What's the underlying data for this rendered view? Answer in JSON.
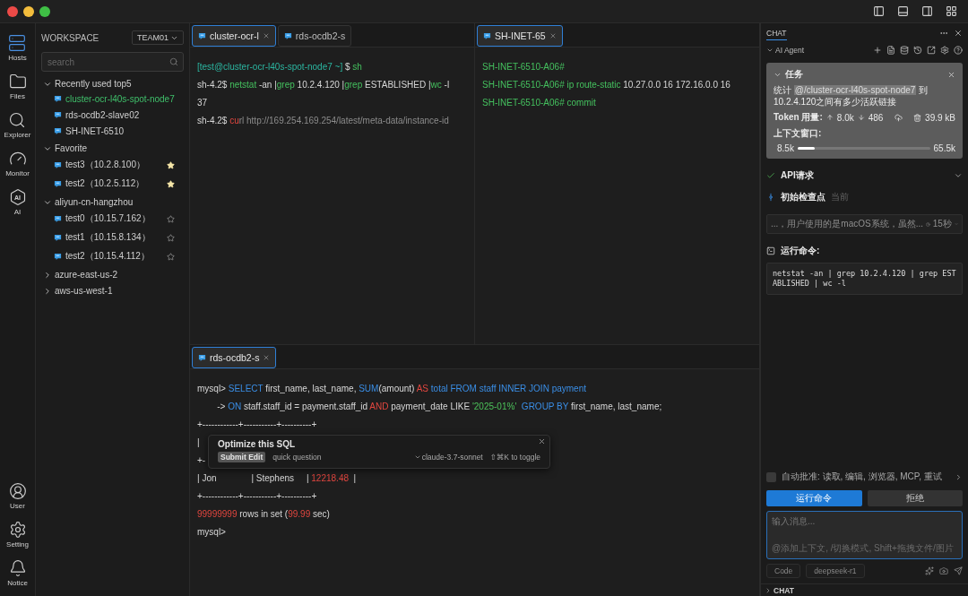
{
  "rail": {
    "top": [
      {
        "kind": "hosts",
        "label": "Hosts",
        "selected": true
      },
      {
        "kind": "files",
        "label": "Files",
        "selected": false
      },
      {
        "kind": "explorer",
        "label": "Explorer",
        "selected": false
      },
      {
        "kind": "monitor",
        "label": "Monitor",
        "selected": false
      },
      {
        "kind": "ai",
        "label": "AI",
        "glyph": "AI",
        "selected": false
      }
    ],
    "bottom": [
      {
        "kind": "user",
        "label": "User",
        "selected": false
      },
      {
        "kind": "settings",
        "label": "Setting",
        "selected": false
      },
      {
        "kind": "notice",
        "label": "Notice",
        "selected": false
      }
    ]
  },
  "sidebar": {
    "title": "WORKSPACE",
    "team": "TEAM01",
    "search": {
      "placeholder": "search"
    },
    "groups": [
      {
        "label": "Recently used top5",
        "expanded": true,
        "children": [
          {
            "label": "cluster-ocr-l40s-spot-node7",
            "selected": true
          },
          {
            "label": "rds-ocdb2-slave02",
            "selected": false
          },
          {
            "label": "SH-INET-6510",
            "selected": false
          }
        ]
      },
      {
        "label": "Favorite",
        "expanded": true,
        "children": [
          {
            "label": "test3（10.2.8.100）",
            "selected": false,
            "starred": true
          },
          {
            "label": "test2（10.2.5.112）",
            "selected": false,
            "starred": true
          }
        ]
      },
      {
        "label": "aliyun-cn-hangzhou",
        "expanded": true,
        "children": [
          {
            "label": "test0（10.15.7.162）",
            "selected": false,
            "starred": false
          },
          {
            "label": "test1（10.15.8.134）",
            "selected": false,
            "starred": false
          },
          {
            "label": "test2（10.15.4.112）",
            "selected": false,
            "starred": false
          }
        ]
      },
      {
        "label": "azure-east-us-2",
        "expanded": false
      },
      {
        "label": "aws-us-west-1",
        "expanded": false
      }
    ]
  },
  "panes": [
    {
      "tabs": [
        {
          "label": "cluster-ocr-l",
          "selected": true,
          "closable": true
        },
        {
          "label": "rds-ocdb2-s",
          "selected": false,
          "closable": false
        }
      ],
      "lines": [
        [
          {
            "kind": "prompt",
            "text": "[test@cluster-ocr-l40s-spot-node7 ~]"
          },
          {
            "kind": "plain",
            "text": " $ "
          },
          {
            "kind": "cmd",
            "text": "sh"
          }
        ],
        [
          {
            "kind": "plain",
            "text": "sh-4.2$ "
          },
          {
            "kind": "cmd",
            "text": "netstat"
          },
          {
            "kind": "plain",
            "text": " -an |"
          },
          {
            "kind": "cmd",
            "text": "grep"
          },
          {
            "kind": "plain",
            "text": " 10.2.4.120 |"
          },
          {
            "kind": "cmd",
            "text": "grep"
          },
          {
            "kind": "plain",
            "text": " ESTABLISHED |"
          },
          {
            "kind": "cmd",
            "text": "wc"
          },
          {
            "kind": "plain",
            "text": " -l"
          }
        ],
        [
          {
            "kind": "plain",
            "text": "37"
          }
        ],
        [
          {
            "kind": "plain",
            "text": "sh-4.2$ "
          },
          {
            "kind": "error",
            "text": "cu"
          },
          {
            "kind": "dim",
            "text": "rl http://169.254.169.254/latest/meta-data/instance-id"
          }
        ]
      ]
    },
    {
      "tabs": [
        {
          "label": "SH-INET-65",
          "selected": true,
          "closable": true
        }
      ],
      "lines": [
        [
          {
            "kind": "cmd",
            "text": "SH-INET-6510-A06#"
          }
        ],
        [
          {
            "kind": "cmd",
            "text": "SH-INET-6510-A06# ip route-static"
          },
          {
            "kind": "plain",
            "text": " 10.27.0.0 16 172.16.0.0 16"
          }
        ],
        [
          {
            "kind": "cmd",
            "text": "SH-INET-6510-A06# commit"
          }
        ]
      ]
    },
    {
      "tabs": [
        {
          "label": "rds-ocdb2-s",
          "selected": true,
          "closable": true
        }
      ],
      "lines": [
        [
          {
            "kind": "plain",
            "text": "mysql> "
          },
          {
            "kind": "keyword",
            "text": "SELECT"
          },
          {
            "kind": "plain",
            "text": " first_name, last_name, "
          },
          {
            "kind": "keyword",
            "text": "SUM"
          },
          {
            "kind": "plain",
            "text": "(amount) "
          },
          {
            "kind": "error",
            "text": "AS"
          },
          {
            "kind": "keyword",
            "text": " total FROM staff INNER JOIN payment"
          }
        ],
        [
          {
            "kind": "plain",
            "text": "        -> "
          },
          {
            "kind": "keyword",
            "text": "ON"
          },
          {
            "kind": "plain",
            "text": " staff.staff_id = payment.staff_id "
          },
          {
            "kind": "error",
            "text": "AND"
          },
          {
            "kind": "plain",
            "text": " payment_date LIKE "
          },
          {
            "kind": "string",
            "text": "'2025-01%'"
          },
          {
            "kind": "keyword",
            "text": "  GROUP BY"
          },
          {
            "kind": "plain",
            "text": " first_name, last_name;"
          }
        ],
        [
          {
            "kind": "plain",
            "text": "+------------+-----------+----------+"
          }
        ],
        [
          {
            "kind": "plain",
            "text": "|"
          }
        ],
        [
          {
            "kind": "plain",
            "text": "+-"
          }
        ],
        [
          {
            "kind": "plain",
            "text": "| Jon              | Stephens     | "
          },
          {
            "kind": "error",
            "text": "12218.48"
          },
          {
            "kind": "plain",
            "text": "  |"
          }
        ],
        [
          {
            "kind": "plain",
            "text": "+------------+-----------+----------+"
          }
        ],
        [
          {
            "kind": "error",
            "text": "99999999"
          },
          {
            "kind": "plain",
            "text": " rows in set ("
          },
          {
            "kind": "error",
            "text": "99.99"
          },
          {
            "kind": "plain",
            "text": " sec)"
          }
        ],
        [
          {
            "kind": "plain",
            "text": "mysql>"
          }
        ]
      ],
      "popup": {
        "title": "Optimize this SQL",
        "submit": "Submit Edit",
        "hint": "quick question",
        "model": "claude-3.7-sonnet",
        "shortcut": "⇧⌘K to toggle"
      }
    }
  ],
  "chat": {
    "tab": "CHAT",
    "agent": "AI Agent",
    "task": {
      "title": "任务",
      "prefix": "统计 ",
      "mention": "@/cluster-ocr-l40s-spot-node7",
      "suffix": " 到10.2.4.120之间有多少活跃链接",
      "token_label": "Token 用量:",
      "up": "8.0k",
      "down": "486",
      "size": "39.9 kB",
      "context_label": "上下文窗口:",
      "context_used": "8.5k",
      "context_max": "65.5k",
      "level": 0.13
    },
    "api": {
      "label": "API请求"
    },
    "checkpoint": {
      "label": "初始检查点",
      "tag": "当前"
    },
    "thought": {
      "text": "...，用户使用的是macOS系统，虽然...",
      "time": "15秒"
    },
    "command": {
      "label": "运行命令:",
      "code": "netstat -an | grep 10.2.4.120 | grep ESTABLISHED | wc -l"
    },
    "auto_approve": {
      "label": "自动批准: 读取, 编辑, 浏览器, MCP, 重试",
      "checked": false
    },
    "buttons": [
      {
        "kind": "primary",
        "label": "运行命令"
      },
      {
        "kind": "secondary",
        "label": "拒绝"
      }
    ],
    "input": {
      "placeholder": "输入消息...",
      "hint": "@添加上下文, /切换模式, Shift+拖拽文件/图片"
    },
    "mode": "Code",
    "model": "deepseek-r1",
    "footer": "CHAT"
  }
}
